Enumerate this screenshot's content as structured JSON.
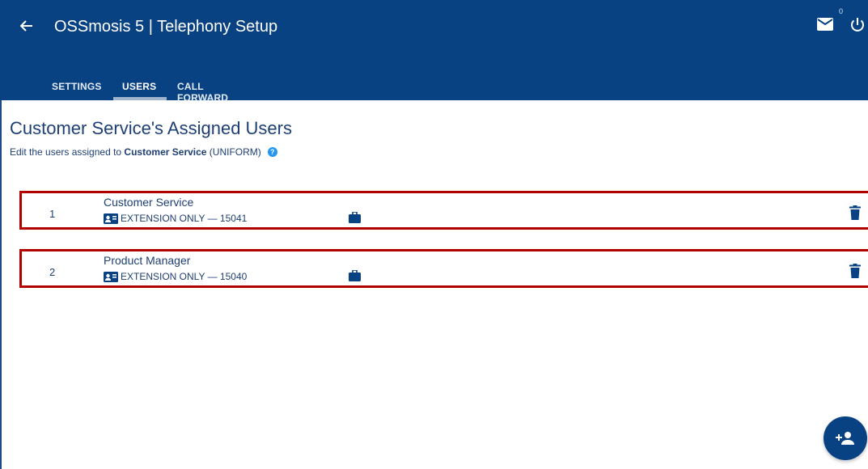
{
  "header": {
    "title": "OSSmosis 5 | Telephony Setup",
    "back_icon": "arrow-left-icon",
    "mail_icon": "mail-icon",
    "mail_count": "0",
    "power_icon": "power-icon"
  },
  "tabs": [
    {
      "label": "SETTINGS",
      "active": false
    },
    {
      "label": "USERS",
      "active": true
    },
    {
      "label": "CALL FORWARD",
      "active": false
    }
  ],
  "main": {
    "title": "Customer Service's Assigned Users",
    "subtitle_prefix": "Edit the users assigned to ",
    "subtitle_group": "Customer Service",
    "subtitle_suffix": " (UNIFORM)",
    "help_icon": "help-icon"
  },
  "users": [
    {
      "index": "1",
      "name": "Customer Service",
      "extension": "EXTENSION ONLY — 15041"
    },
    {
      "index": "2",
      "name": "Product Manager",
      "extension": "EXTENSION ONLY — 15040"
    }
  ],
  "fab": {
    "icon": "add-person-icon"
  },
  "colors": {
    "header": "#084283",
    "text": "#1e3f73",
    "highlight": "#b00000",
    "help": "#2196f3"
  }
}
